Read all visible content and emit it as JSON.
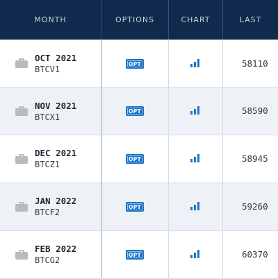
{
  "header": {
    "month": "MONTH",
    "options": "OPTIONS",
    "chart": "CHART",
    "last": "LAST"
  },
  "opt_badge": "OPT",
  "rows": [
    {
      "month": "OCT 2021",
      "code": "BTCV1",
      "last": "58110"
    },
    {
      "month": "NOV 2021",
      "code": "BTCX1",
      "last": "58590"
    },
    {
      "month": "DEC 2021",
      "code": "BTCZ1",
      "last": "58945"
    },
    {
      "month": "JAN 2022",
      "code": "BTCF2",
      "last": "59260"
    },
    {
      "month": "FEB 2022",
      "code": "BTCG2",
      "last": "60370"
    }
  ],
  "icons": {
    "row": "briefcase-icon",
    "options": "opt-badge-icon",
    "chart": "bar-chart-icon"
  },
  "colors": {
    "header_bg": "#0f2a4c",
    "accent": "#1c73c8",
    "row_alt": "#eef2f6"
  }
}
